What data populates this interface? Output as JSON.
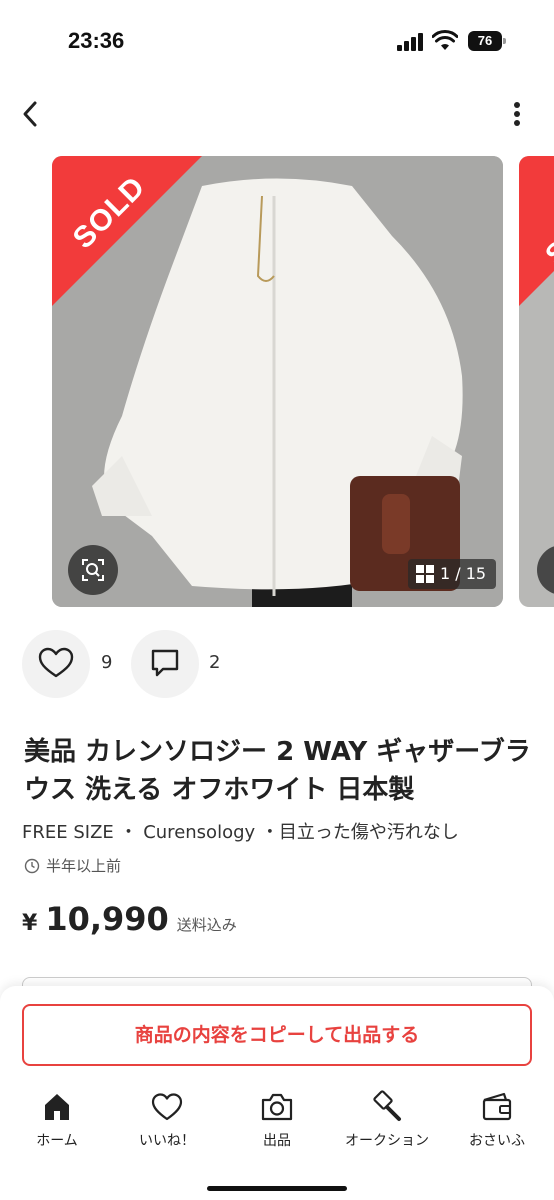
{
  "status_bar": {
    "time": "23:36",
    "battery": "76"
  },
  "carousel": {
    "sold_label": "SOLD",
    "counter": "1 / 15"
  },
  "actions": {
    "like_count": "9",
    "comment_count": "2"
  },
  "item": {
    "title": "美品 カレンソロジー 2 WAY ギャザーブラウス 洗える オフホワイト 日本製",
    "subtitle": "FREE SIZE ・ Curensology ・目立った傷や汚れなし",
    "posted": "半年以上前",
    "price_symbol": "¥",
    "price": "10,990",
    "price_note": "送料込み"
  },
  "copy_button": "商品の内容をコピーして出品する",
  "tabs": [
    {
      "label": "ホーム",
      "icon": "home-icon"
    },
    {
      "label": "いいね！",
      "icon": "heart-icon"
    },
    {
      "label": "出品",
      "icon": "camera-icon"
    },
    {
      "label": "オークション",
      "icon": "gavel-icon"
    },
    {
      "label": "おさいふ",
      "icon": "wallet-icon"
    }
  ],
  "colors": {
    "accent": "#e8423f",
    "sold_ribbon": "#f23b3b"
  }
}
